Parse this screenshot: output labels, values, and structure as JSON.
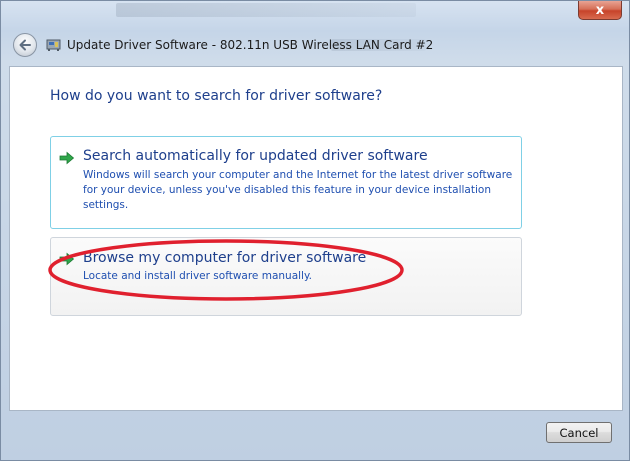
{
  "window": {
    "title": "Update Driver Software - 802.11n USB Wireless LAN Card #2",
    "close_label": "x"
  },
  "main": {
    "heading": "How do you want to search for driver software?",
    "options": [
      {
        "title": "Search automatically for updated driver software",
        "description": "Windows will search your computer and the Internet for the latest driver software for your device, unless you've disabled this feature in your device installation settings."
      },
      {
        "title": "Browse my computer for driver software",
        "description": "Locate and install driver software manually."
      }
    ]
  },
  "footer": {
    "cancel_label": "Cancel"
  },
  "colors": {
    "heading": "#1e3f8c",
    "link_text": "#1f4fb0",
    "arrow": "#2fa64a",
    "annotation": "#e0202e",
    "close_button": "#c7432a"
  },
  "icons": {
    "back": "back-arrow-icon",
    "driver": "driver-card-icon",
    "option_arrow": "green-arrow-icon"
  }
}
